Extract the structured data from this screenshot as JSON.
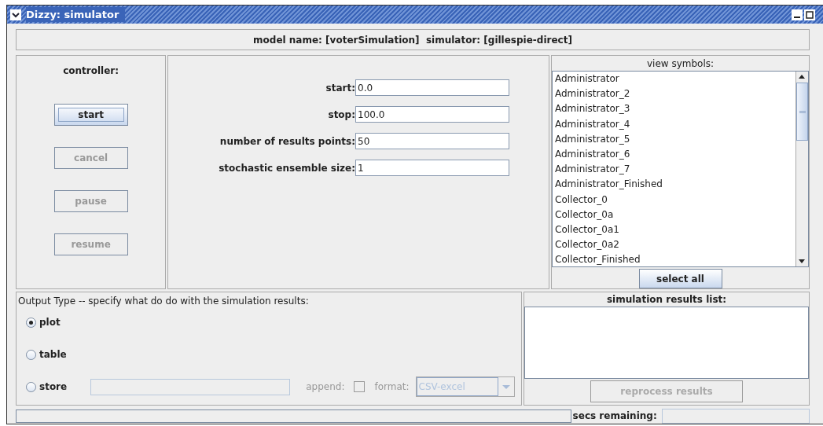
{
  "window": {
    "title": "Dizzy: simulator"
  },
  "header": "model name: [voterSimulation]  simulator: [gillespie-direct]",
  "controller": {
    "label": "controller:",
    "buttons": [
      {
        "label": "start",
        "disabled": false,
        "focused": true
      },
      {
        "label": "cancel",
        "disabled": true,
        "focused": false
      },
      {
        "label": "pause",
        "disabled": true,
        "focused": false
      },
      {
        "label": "resume",
        "disabled": true,
        "focused": false
      }
    ]
  },
  "parameters": [
    {
      "label": "start:",
      "value": "0.0"
    },
    {
      "label": "stop:",
      "value": "100.0"
    },
    {
      "label": "number of results points:",
      "value": "50"
    },
    {
      "label": "stochastic ensemble size:",
      "value": "1"
    }
  ],
  "symbols": {
    "title": "view symbols:",
    "items": [
      "Administrator",
      "Administrator_2",
      "Administrator_3",
      "Administrator_4",
      "Administrator_5",
      "Administrator_6",
      "Administrator_7",
      "Administrator_Finished",
      "Collector_0",
      "Collector_0a",
      "Collector_0a1",
      "Collector_0a2",
      "Collector_Finished"
    ],
    "select_all": "select all"
  },
  "output": {
    "label": "Output Type -- specify what do do with the simulation results:",
    "options": [
      {
        "label": "plot",
        "selected": true
      },
      {
        "label": "table",
        "selected": false
      },
      {
        "label": "store",
        "selected": false
      }
    ],
    "append_label": "append:",
    "append_checked": false,
    "format_label": "format:",
    "format_value": "CSV-excel"
  },
  "results": {
    "title": "simulation results list:",
    "reprocess": "reprocess results",
    "reprocess_disabled": true
  },
  "status": {
    "progress": {
      "level": 0
    },
    "secs_label": "secs remaining:"
  }
}
